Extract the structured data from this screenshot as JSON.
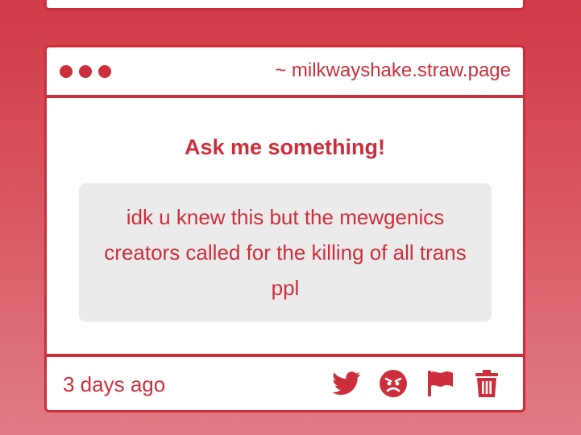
{
  "header": {
    "site_url": "~ milkwayshake.straw.page"
  },
  "body": {
    "title": "Ask me something!",
    "question": "idk u knew this but the mewgenics creators called for the killing of all trans ppl"
  },
  "footer": {
    "timestamp": "3 days ago",
    "actions": [
      "twitter-share-icon",
      "angry-face-icon",
      "flag-icon",
      "trash-icon"
    ]
  },
  "colors": {
    "accent": "#cc2f3b",
    "question_bg": "#ebebeb",
    "card_bg": "#ffffff",
    "page_gradient_top": "#d23b47",
    "page_gradient_bottom": "#e07b85"
  }
}
